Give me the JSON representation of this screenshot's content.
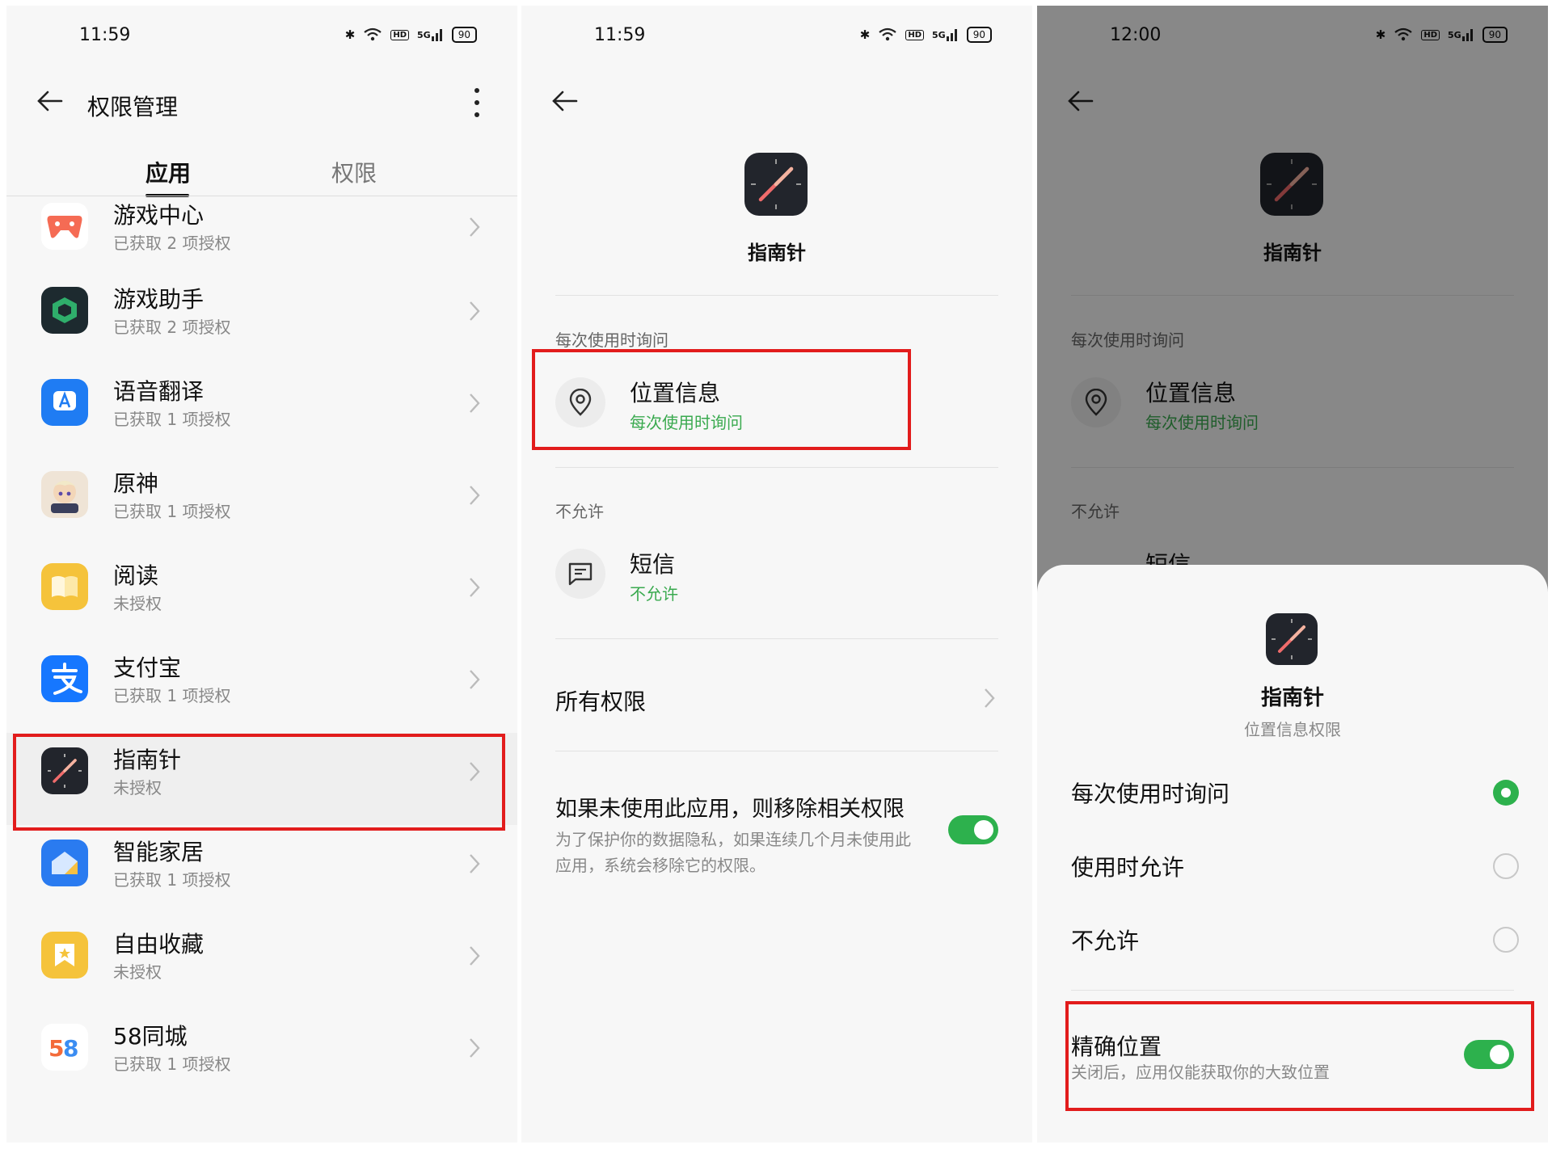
{
  "panel1": {
    "status": {
      "time": "11:59",
      "signal": "5G",
      "battery": "90"
    },
    "header": {
      "title": "权限管理"
    },
    "tabs": [
      {
        "label": "应用"
      },
      {
        "label": "权限"
      }
    ],
    "apps": [
      {
        "name": "游戏中心",
        "status": "已获取 2 项授权",
        "icon": "game-center-icon",
        "color": "#f56b54"
      },
      {
        "name": "游戏助手",
        "status": "已获取 2 项授权",
        "icon": "game-assistant-icon",
        "color": "#1d2a2f"
      },
      {
        "name": "语音翻译",
        "status": "已获取 1 项授权",
        "icon": "translate-icon",
        "color": "#1f7cf3"
      },
      {
        "name": "原神",
        "status": "已获取 1 项授权",
        "icon": "genshin-icon",
        "color": "#e8d9c4"
      },
      {
        "name": "阅读",
        "status": "未授权",
        "icon": "book-icon",
        "color": "#f5c33b"
      },
      {
        "name": "支付宝",
        "status": "已获取 1 项授权",
        "icon": "alipay-icon",
        "color": "#1677ff"
      },
      {
        "name": "指南针",
        "status": "未授权",
        "icon": "compass-icon",
        "color": "#22252c"
      },
      {
        "name": "智能家居",
        "status": "已获取 1 项授权",
        "icon": "smart-home-icon",
        "color": "#2a7bf0"
      },
      {
        "name": "自由收藏",
        "status": "未授权",
        "icon": "bookmark-icon",
        "color": "#f5c33b"
      },
      {
        "name": "58同城",
        "status": "已获取 1 项授权",
        "icon": "58-icon",
        "color": "#ffffff"
      }
    ]
  },
  "panel2": {
    "status": {
      "time": "11:59",
      "signal": "5G",
      "battery": "90"
    },
    "app_name": "指南针",
    "section_ask": "每次使用时询问",
    "location": {
      "title": "位置信息",
      "value": "每次使用时询问"
    },
    "section_deny": "不允许",
    "sms": {
      "title": "短信",
      "value": "不允许"
    },
    "all_permissions": "所有权限",
    "remove_unused": {
      "title": "如果未使用此应用，则移除相关权限",
      "desc": "为了保护你的数据隐私，如果连续几个月未使用此应用，系统会移除它的权限。",
      "enabled": true
    }
  },
  "panel3": {
    "status": {
      "time": "12:00",
      "signal": "5G",
      "battery": "90"
    },
    "app_name": "指南针",
    "section_ask": "每次使用时询问",
    "location": {
      "title": "位置信息",
      "value": "每次使用时询问"
    },
    "section_deny": "不允许",
    "sms_partial": "短信",
    "sheet": {
      "app_name": "指南针",
      "subtitle": "位置信息权限",
      "options": [
        {
          "label": "每次使用时询问",
          "selected": true
        },
        {
          "label": "使用时允许",
          "selected": false
        },
        {
          "label": "不允许",
          "selected": false
        }
      ],
      "precise": {
        "title": "精确位置",
        "desc": "关闭后，应用仅能获取你的大致位置",
        "enabled": true
      }
    }
  }
}
